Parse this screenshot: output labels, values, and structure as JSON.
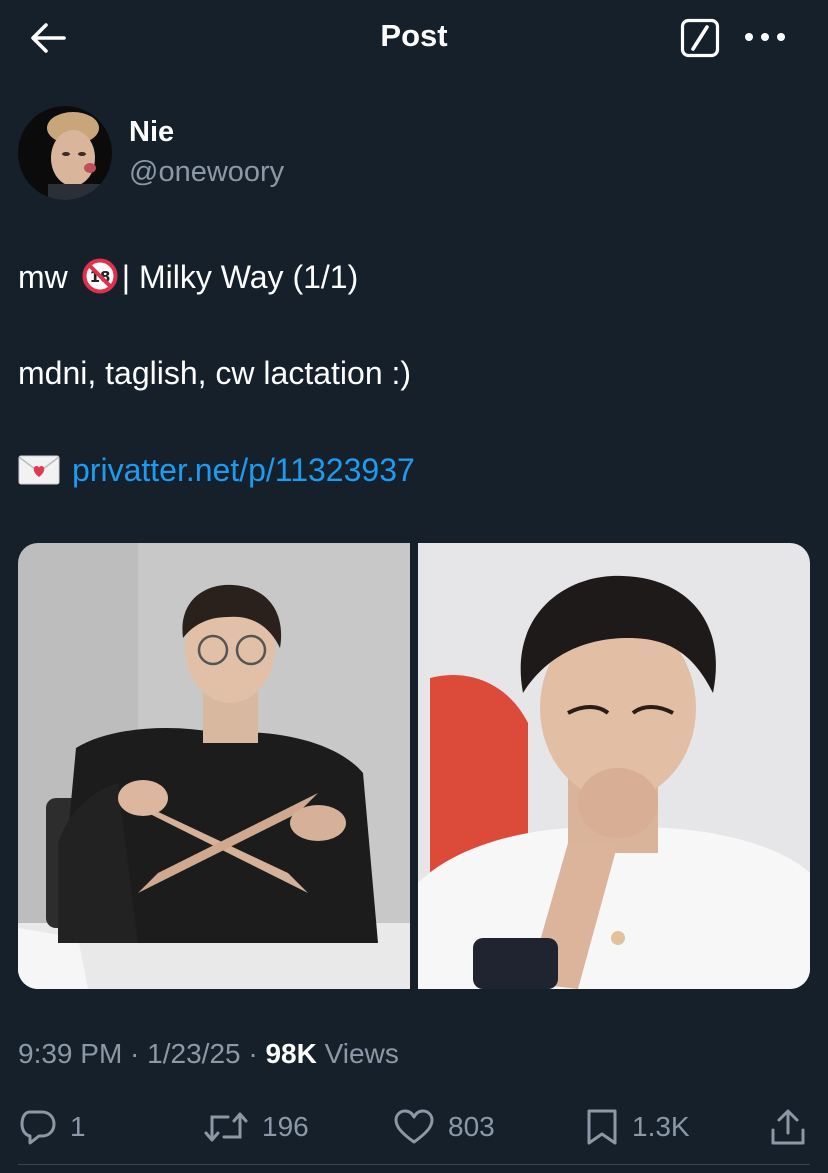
{
  "header": {
    "title": "Post",
    "back_icon": "arrow-left-icon",
    "grok_icon": "grok-icon",
    "more_icon": "more-horizontal-icon"
  },
  "author": {
    "name": "Nie",
    "handle": "@onewoory"
  },
  "post": {
    "line1_prefix": "mw",
    "line1_suffix": "| Milky Way (1/1)",
    "line2": "mdni, taglish, cw lactation :)",
    "link_text": "privatter.net/p/11323937",
    "badge_icon": "no-under-18-icon",
    "envelope_icon": "love-letter-icon"
  },
  "meta": {
    "time": "9:39 PM",
    "sep1": " · ",
    "date": "1/23/25",
    "sep2": " · ",
    "views_count": "98K",
    "views_label": " Views"
  },
  "actions": {
    "replies": "1",
    "reposts": "196",
    "likes": "803",
    "bookmarks": "1.3K"
  },
  "colors": {
    "background": "#15202b",
    "link": "#1d9bf0",
    "muted": "#8b98a5",
    "divider": "#38444d"
  }
}
